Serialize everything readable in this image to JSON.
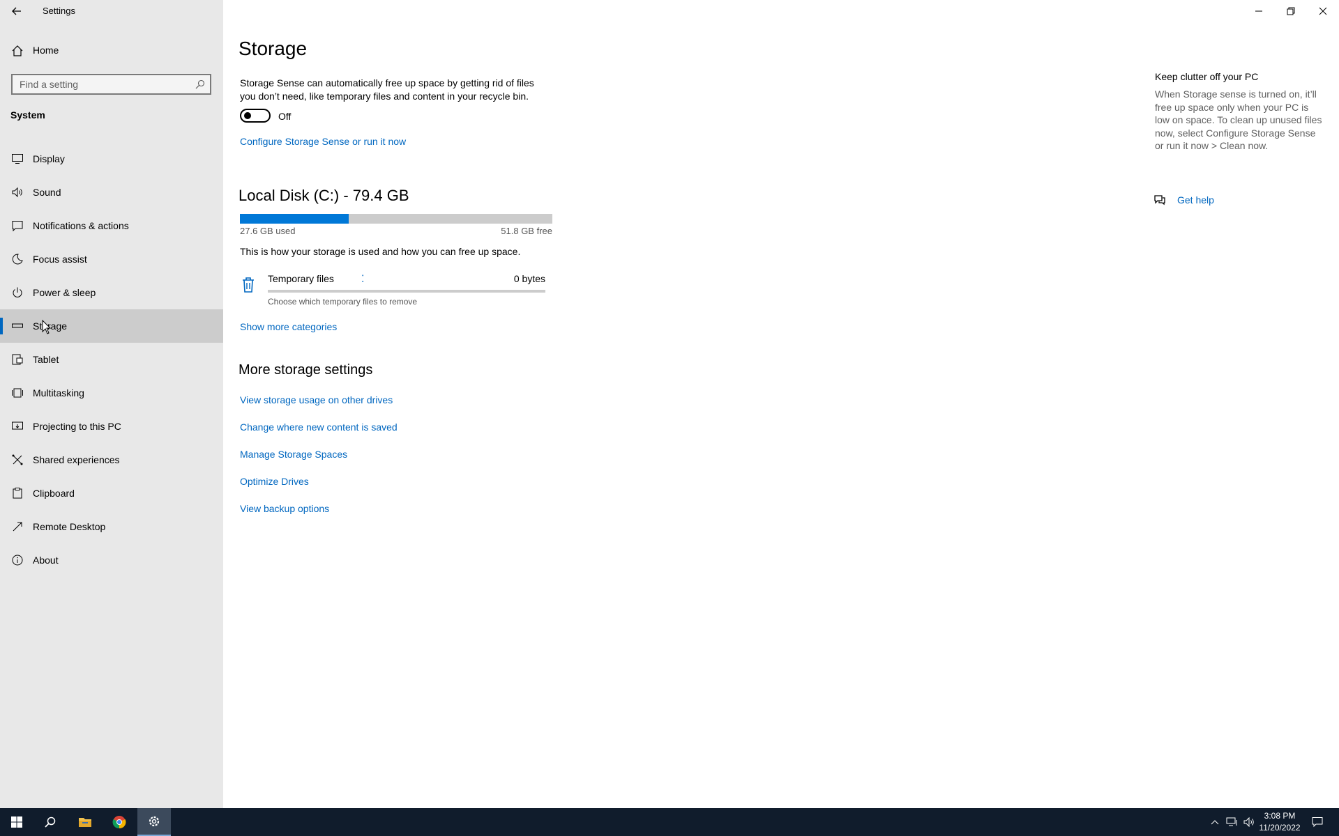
{
  "window": {
    "app_title": "Settings",
    "back_icon": "back-arrow-icon",
    "controls": {
      "minimize": "minimize-icon",
      "restore": "restore-icon",
      "close": "close-icon"
    }
  },
  "sidebar": {
    "home_label": "Home",
    "search_placeholder": "Find a setting",
    "section": "System",
    "items": [
      {
        "label": "Display",
        "icon": "monitor-icon"
      },
      {
        "label": "Sound",
        "icon": "speaker-icon"
      },
      {
        "label": "Notifications & actions",
        "icon": "notification-icon"
      },
      {
        "label": "Focus assist",
        "icon": "moon-icon"
      },
      {
        "label": "Power & sleep",
        "icon": "power-icon"
      },
      {
        "label": "Storage",
        "icon": "storage-drive-icon",
        "active": true
      },
      {
        "label": "Tablet",
        "icon": "tablet-icon"
      },
      {
        "label": "Multitasking",
        "icon": "multitasking-icon"
      },
      {
        "label": "Projecting to this PC",
        "icon": "projecting-icon"
      },
      {
        "label": "Shared experiences",
        "icon": "shared-experiences-icon"
      },
      {
        "label": "Clipboard",
        "icon": "clipboard-icon"
      },
      {
        "label": "Remote Desktop",
        "icon": "remote-desktop-icon"
      },
      {
        "label": "About",
        "icon": "info-icon"
      }
    ]
  },
  "main": {
    "title": "Storage",
    "sense_description": "Storage Sense can automatically free up space by getting rid of files you don’t need, like temporary files and content in your recycle bin.",
    "toggle_state": "Off",
    "toggle_on": false,
    "configure_link": "Configure Storage Sense or run it now",
    "disk": {
      "title": "Local Disk (C:) - 79.4 GB",
      "used_label": "27.6 GB used",
      "free_label": "51.8 GB free",
      "used_fraction": 0.348
    },
    "usage_description": "This is how your storage is used and how you can free up space.",
    "category": {
      "name": "Temporary files",
      "size": "0 bytes",
      "description": "Choose which temporary files to remove",
      "icon": "trash-icon",
      "loading_glyph": "⁚"
    },
    "show_more": "Show more categories",
    "more_title": "More storage settings",
    "more_links": [
      "View storage usage on other drives",
      "Change where new content is saved",
      "Manage Storage Spaces",
      "Optimize Drives",
      "View backup options"
    ]
  },
  "help": {
    "heading": "Keep clutter off your PC",
    "text": "When Storage sense is turned on, it’ll free up space only when your PC is low on space. To clean up unused files now, select Configure Storage Sense or run it now > Clean now.",
    "get_help": "Get help"
  },
  "taskbar": {
    "time": "3:08 PM",
    "date": "11/20/2022"
  },
  "colors": {
    "accent": "#0067c0",
    "bar_fill": "#0078d7",
    "sidebar_bg": "#e8e8e8",
    "taskbar_bg": "#101c2c"
  }
}
